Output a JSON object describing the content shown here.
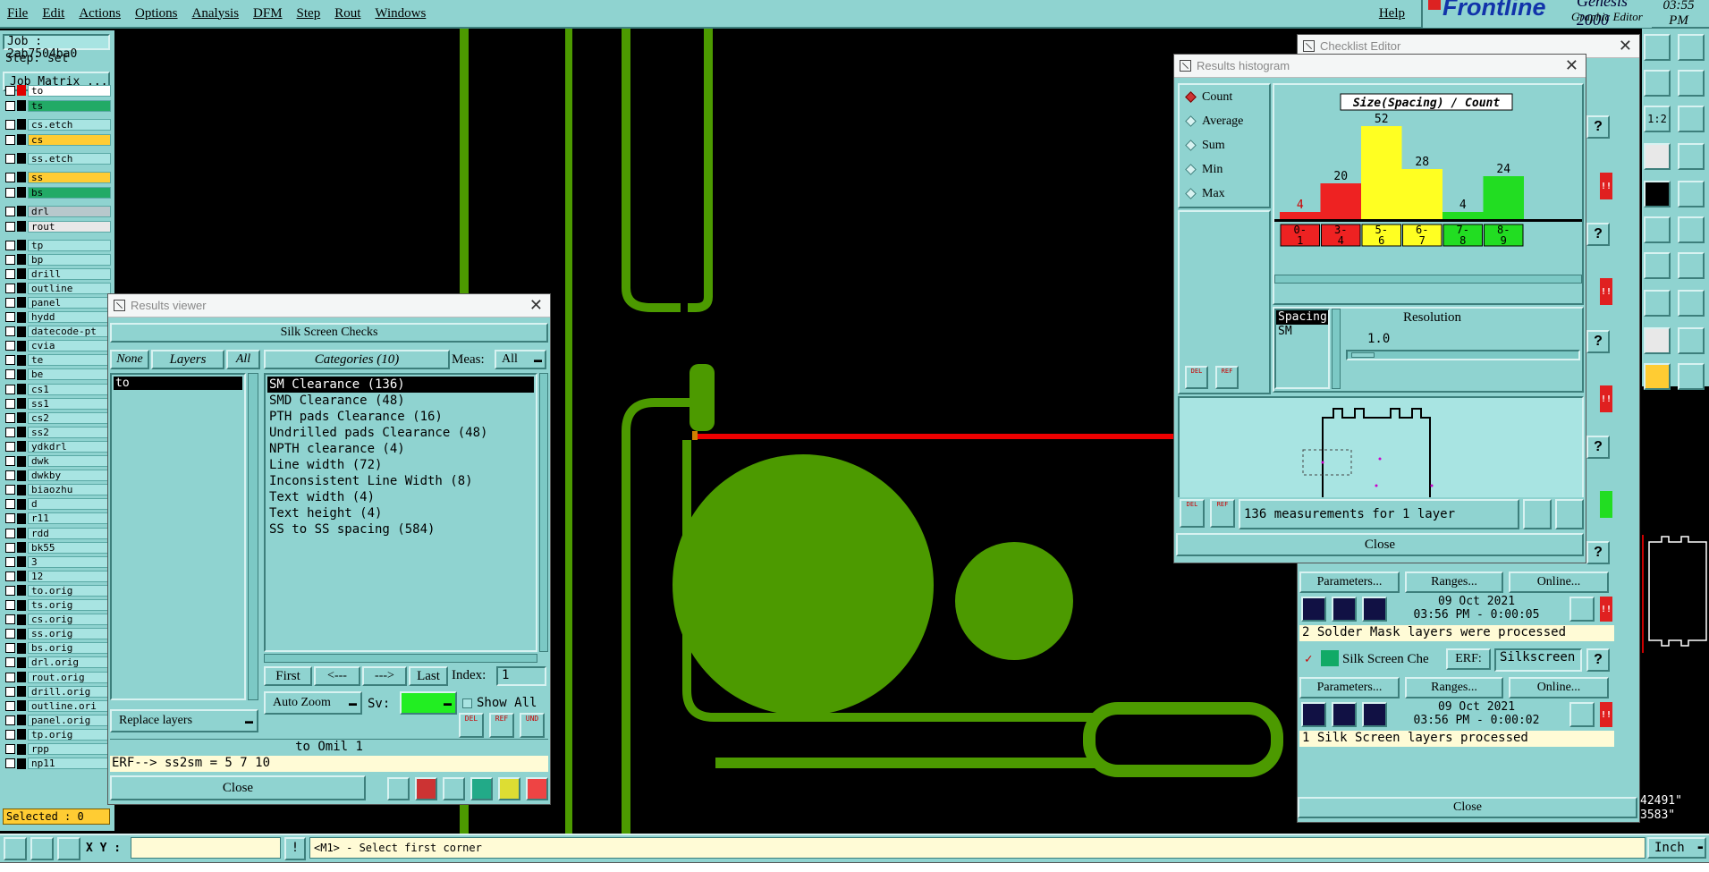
{
  "menu": {
    "items": [
      "File",
      "Edit",
      "Actions",
      "Options",
      "Analysis",
      "DFM",
      "Step",
      "Rout",
      "Windows"
    ],
    "help": "Help",
    "brand": "Frontline",
    "product": "Genesis 2000",
    "subtitle": "Graphic Editor",
    "clock": "03:55 PM"
  },
  "left_panel": {
    "job": "Job : 2ab7504ba0",
    "step": "Step: set",
    "job_matrix": "Job Matrix ...",
    "selected": "Selected : 0",
    "layers": [
      {
        "name": "to",
        "color": "#ffffff",
        "swatch": "#e00000"
      },
      {
        "name": "ts",
        "color": "#22aa66",
        "swatch": "#000000"
      },
      {
        "name": "cs.etch",
        "color": "#a8e4e2",
        "swatch": "#000000"
      },
      {
        "name": "cs",
        "color": "#ffcc33",
        "swatch": "#000000"
      },
      {
        "name": "ss.etch",
        "color": "#a8e4e2",
        "swatch": "#000000"
      },
      {
        "name": "ss",
        "color": "#ffcc33",
        "swatch": "#000000"
      },
      {
        "name": "bs",
        "color": "#22aa66",
        "swatch": "#000000"
      },
      {
        "name": "drl",
        "color": "#b7c8cc",
        "swatch": "#000000"
      },
      {
        "name": "rout",
        "color": "#e8e8e8",
        "swatch": "#000000"
      },
      {
        "name": "tp",
        "color": "#a8e4e2",
        "swatch": "#000000"
      },
      {
        "name": "bp",
        "color": "#a8e4e2",
        "swatch": "#000000"
      },
      {
        "name": "drill",
        "color": "#a8e4e2",
        "swatch": "#000000"
      },
      {
        "name": "outline",
        "color": "#a8e4e2",
        "swatch": "#000000"
      },
      {
        "name": "panel",
        "color": "#a8e4e2",
        "swatch": "#000000"
      },
      {
        "name": "hydd",
        "color": "#a8e4e2",
        "swatch": "#000000"
      },
      {
        "name": "datecode-pt",
        "color": "#a8e4e2",
        "swatch": "#000000"
      },
      {
        "name": "cvia",
        "color": "#a8e4e2",
        "swatch": "#000000"
      },
      {
        "name": "te",
        "color": "#a8e4e2",
        "swatch": "#000000"
      },
      {
        "name": "be",
        "color": "#a8e4e2",
        "swatch": "#000000"
      },
      {
        "name": "cs1",
        "color": "#a8e4e2",
        "swatch": "#000000"
      },
      {
        "name": "ss1",
        "color": "#a8e4e2",
        "swatch": "#000000"
      },
      {
        "name": "cs2",
        "color": "#a8e4e2",
        "swatch": "#000000"
      },
      {
        "name": "ss2",
        "color": "#a8e4e2",
        "swatch": "#000000"
      },
      {
        "name": "ydkdrl",
        "color": "#a8e4e2",
        "swatch": "#000000"
      },
      {
        "name": "dwk",
        "color": "#a8e4e2",
        "swatch": "#000000"
      },
      {
        "name": "dwkby",
        "color": "#a8e4e2",
        "swatch": "#000000"
      },
      {
        "name": "biaozhu",
        "color": "#a8e4e2",
        "swatch": "#000000"
      },
      {
        "name": "d",
        "color": "#a8e4e2",
        "swatch": "#000000"
      },
      {
        "name": "r11",
        "color": "#a8e4e2",
        "swatch": "#000000"
      },
      {
        "name": "rdd",
        "color": "#a8e4e2",
        "swatch": "#000000"
      },
      {
        "name": "bk55",
        "color": "#a8e4e2",
        "swatch": "#000000"
      },
      {
        "name": "3",
        "color": "#a8e4e2",
        "swatch": "#000000"
      },
      {
        "name": "12",
        "color": "#a8e4e2",
        "swatch": "#000000"
      },
      {
        "name": "to.orig",
        "color": "#a8e4e2",
        "swatch": "#000000"
      },
      {
        "name": "ts.orig",
        "color": "#a8e4e2",
        "swatch": "#000000"
      },
      {
        "name": "cs.orig",
        "color": "#a8e4e2",
        "swatch": "#000000"
      },
      {
        "name": "ss.orig",
        "color": "#a8e4e2",
        "swatch": "#000000"
      },
      {
        "name": "bs.orig",
        "color": "#a8e4e2",
        "swatch": "#000000"
      },
      {
        "name": "drl.orig",
        "color": "#a8e4e2",
        "swatch": "#000000"
      },
      {
        "name": "rout.orig",
        "color": "#a8e4e2",
        "swatch": "#000000"
      },
      {
        "name": "drill.orig",
        "color": "#a8e4e2",
        "swatch": "#000000"
      },
      {
        "name": "outline.ori",
        "color": "#a8e4e2",
        "swatch": "#000000"
      },
      {
        "name": "panel.orig",
        "color": "#a8e4e2",
        "swatch": "#000000"
      },
      {
        "name": "tp.orig",
        "color": "#a8e4e2",
        "swatch": "#000000"
      },
      {
        "name": "rpp",
        "color": "#a8e4e2",
        "swatch": "#000000"
      },
      {
        "name": "np11",
        "color": "#a8e4e2",
        "swatch": "#000000"
      }
    ]
  },
  "results_viewer": {
    "title": "Results viewer",
    "header": "Silk Screen Checks",
    "none": "None",
    "layers": "Layers",
    "all": "All",
    "categories_label": "Categories (10)",
    "meas_label": "Meas:",
    "meas_value": "All",
    "layer_list": [
      "to"
    ],
    "categories": [
      "SM Clearance (136)",
      "SMD Clearance (48)",
      "PTH pads Clearance (16)",
      "Undrilled pads Clearance (48)",
      "NPTH clearance (4)",
      "Line width (72)",
      "Inconsistent Line Width (8)",
      "Text width (4)",
      "Text height (4)",
      "SS to SS spacing (584)"
    ],
    "first": "First",
    "prev": "<---",
    "next": "--->",
    "last": "Last",
    "index_label": "Index:",
    "index_value": "1",
    "auto_zoom": "Auto Zoom",
    "sv_label": "Sv:",
    "show_all": "Show All",
    "replace_layers": "Replace layers",
    "status": "to Omil  1",
    "erf": "ERF--> ss2sm = 5 7 10",
    "close": "Close"
  },
  "histogram": {
    "title": "Results histogram",
    "options": [
      "Count",
      "Average",
      "Sum",
      "Min",
      "Max"
    ],
    "selected_option": "Count",
    "spacing_label": "Spacing",
    "sm_label": "SM",
    "resolution_label": "Resolution",
    "resolution_value": "1.0",
    "measurements": "136 measurements for 1 layer",
    "close": "Close",
    "del": "DEL",
    "ref": "REF"
  },
  "chart_data": {
    "type": "bar",
    "title": "Size(Spacing) / Count",
    "categories": [
      "0-1",
      "3-4",
      "5-6",
      "6-7",
      "7-8",
      "8-9"
    ],
    "values": [
      4,
      20,
      52,
      28,
      4,
      24
    ],
    "colors": [
      "#ee2222",
      "#ee2222",
      "#ffff22",
      "#ffff22",
      "#22dd22",
      "#22dd22"
    ],
    "ylim": [
      0,
      52
    ]
  },
  "checklist": {
    "title": "Checklist Editor",
    "parameters": "Parameters...",
    "ranges": "Ranges...",
    "online": "Online...",
    "run1_date": "09 Oct 2021",
    "run1_time": "03:56 PM - 0:00:05",
    "run1_msg": "2 Solder Mask layers were processed",
    "silk_name": "Silk Screen Che",
    "erf_label": "ERF:",
    "erf_value": "Silkscreen",
    "run2_date": "09 Oct 2021",
    "run2_time": "03:56 PM - 0:00:02",
    "run2_msg": "1 Silk Screen layers processed",
    "close": "Close",
    "coords_line1": "42491\"",
    "coords_line2": "3583\""
  },
  "bottom": {
    "xy_label": "X Y :",
    "prompt": "<M1> - Select first corner",
    "units": "Inch"
  },
  "colors": {
    "ui_teal": "#8fd3d0",
    "copper_green": "#4c9a00",
    "highlight_red": "#ee0000"
  }
}
